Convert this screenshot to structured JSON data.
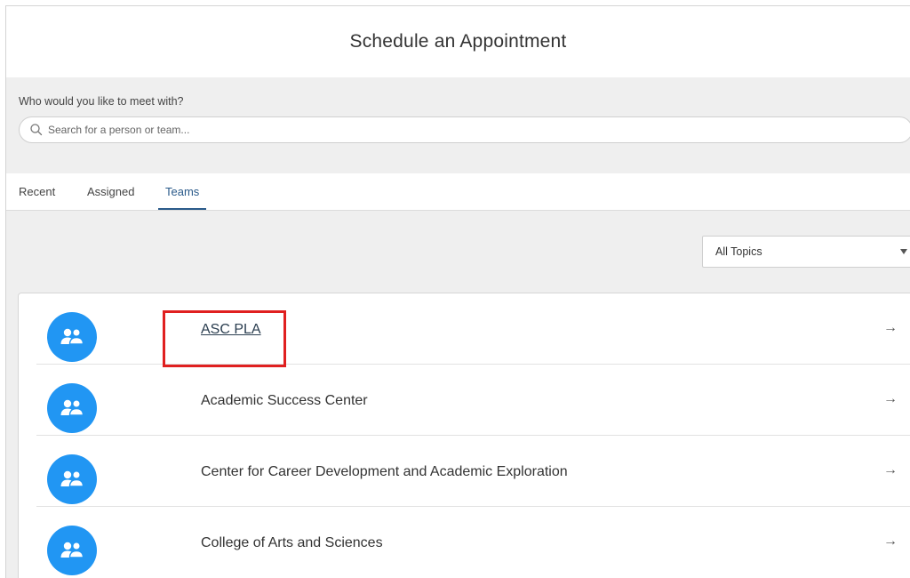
{
  "header": {
    "title": "Schedule an Appointment"
  },
  "who": {
    "label": "Who would you like to meet with?",
    "search_placeholder": "Search for a person or team..."
  },
  "tabs": [
    {
      "label": "Recent",
      "active": false
    },
    {
      "label": "Assigned",
      "active": false
    },
    {
      "label": "Teams",
      "active": true
    }
  ],
  "filter": {
    "selected": "All Topics"
  },
  "teams": [
    {
      "name": "ASC PLA",
      "icon": "team-icon",
      "arrow": "→"
    },
    {
      "name": "Academic Success Center",
      "icon": "team-icon",
      "arrow": "→"
    },
    {
      "name": "Center for Career Development and Academic Exploration",
      "icon": "team-icon",
      "arrow": "→"
    },
    {
      "name": "College of Arts and Sciences",
      "icon": "team-icon",
      "arrow": "→"
    }
  ],
  "colors": {
    "accent": "#2196f3",
    "active_tab": "#2a5a8a",
    "highlight": "#e02020",
    "panel_bg": "#efefef"
  }
}
